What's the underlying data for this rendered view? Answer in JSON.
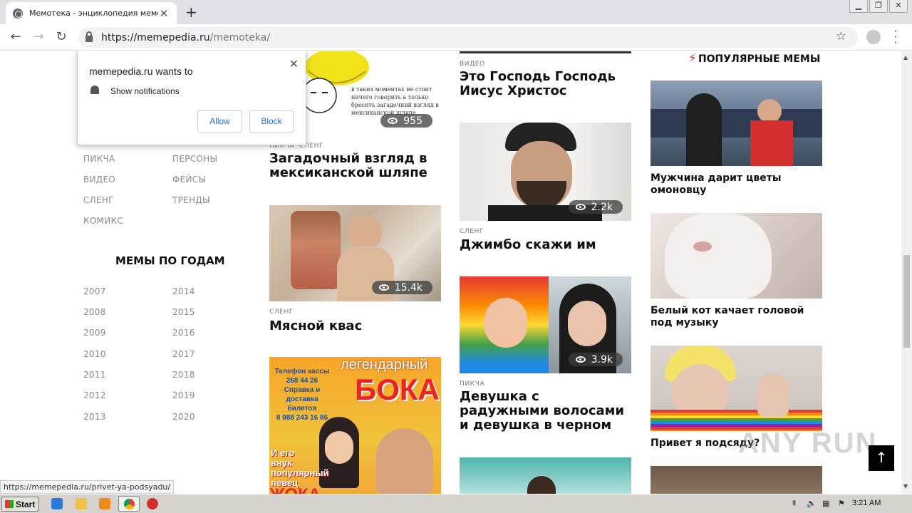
{
  "browser": {
    "tab_title": "Мемотека - энциклопедия мемов",
    "url_host": "https://memepedia.ru",
    "url_path": "/memoteka/",
    "status_url": "https://memepedia.ru/privet-ya-podsyadu/"
  },
  "notification": {
    "title": "memepedia.ru wants to",
    "message": "Show notifications",
    "allow": "Allow",
    "block": "Block"
  },
  "sidebar": {
    "categories_left": [
      "ПИКЧА",
      "ВИДЕО",
      "СЛЕНГ",
      "КОМИКС"
    ],
    "categories_right": [
      "ПЕРСОНЫ",
      "ФЕЙСЫ",
      "ТРЕНДЫ"
    ],
    "years_heading": "МЕМЫ ПО ГОДАМ",
    "years_left": [
      "2007",
      "2008",
      "2009",
      "2010",
      "2011",
      "2012",
      "2013"
    ],
    "years_right": [
      "2014",
      "2015",
      "2016",
      "2017",
      "2018",
      "2019",
      "2020"
    ]
  },
  "col1": {
    "card1": {
      "views": "955",
      "tags": "ПИКЧА  СЛЕНГ",
      "title": "Загадочный взгляд в мексиканской шляпе",
      "img_text": "в таких моментах не стоит ничего говорить а только бросить загадочний взгляд в мексиканской шляпе"
    },
    "card2": {
      "views": "15.4k",
      "tag": "СЛЕНГ",
      "title": "Мясной квас"
    },
    "card3": {
      "poster_lines": [
        "Телефон кассы",
        "268 44 26",
        "Справка и",
        "доставка билетов",
        "8 988 243 16 86"
      ],
      "poster_big": "легендарный",
      "poster_name": "БОКА",
      "poster_bottom": [
        "И его",
        "внук",
        "популярный",
        "певец"
      ],
      "poster_bottom_big": "ЖОКА"
    }
  },
  "col2": {
    "card0": {
      "tag": "ВИДЕО",
      "title": "Это Господь Господь Иисус Христос"
    },
    "card1": {
      "views": "2.2k",
      "tag": "СЛЕНГ",
      "title": "Джимбо скажи им"
    },
    "card2": {
      "views": "3.9k",
      "tag": "ПИКЧА",
      "title": "Девушка с радужными волосами и девушка в черном"
    }
  },
  "popular": {
    "heading": "ПОПУЛЯРНЫЕ МЕМЫ",
    "items": [
      "Мужчина дарит цветы омоновцу",
      "Белый кот качает головой под музыку",
      "Привет я подсяду?"
    ]
  },
  "watermark": "ANY RUN",
  "taskbar": {
    "start": "Start",
    "clock": "3:21 AM"
  }
}
